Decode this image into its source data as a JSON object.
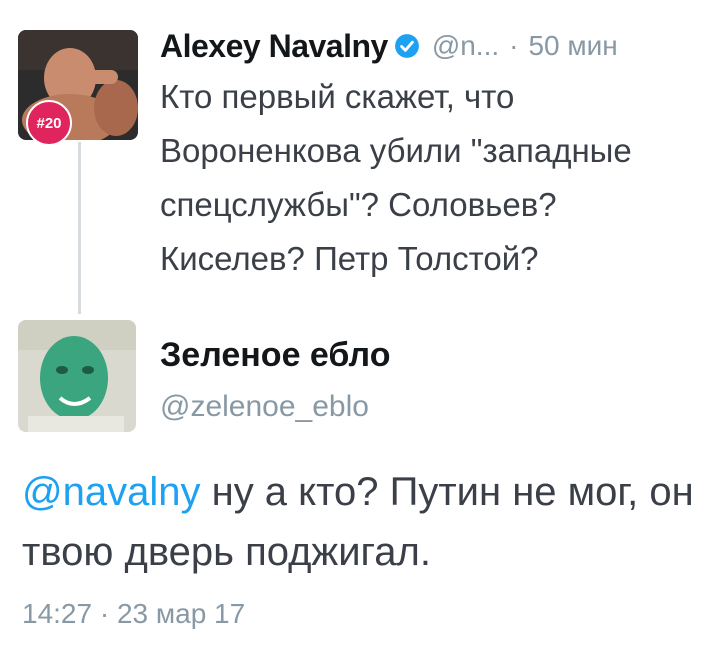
{
  "tweet1": {
    "badge": "#20",
    "name": "Alexey Navalny",
    "handle": "@n...",
    "separator": "·",
    "time": "50 мин",
    "text": "Кто первый скажет, что Вороненкова убили \"западные спецслужбы\"? Соловьев? Киселев? Петр Толстой?"
  },
  "tweet2": {
    "name": "Зеленое ебло",
    "handle": "@zelenoe_eblo",
    "mention": "@navalny",
    "text": " ну а кто? Путин не мог, он твою дверь поджигал.",
    "timestamp": "14:27 · 23 мар 17"
  },
  "colors": {
    "mention": "#1da1f2",
    "verified": "#1da1f2",
    "meta": "#8899a6",
    "badge": "#e0245e"
  }
}
